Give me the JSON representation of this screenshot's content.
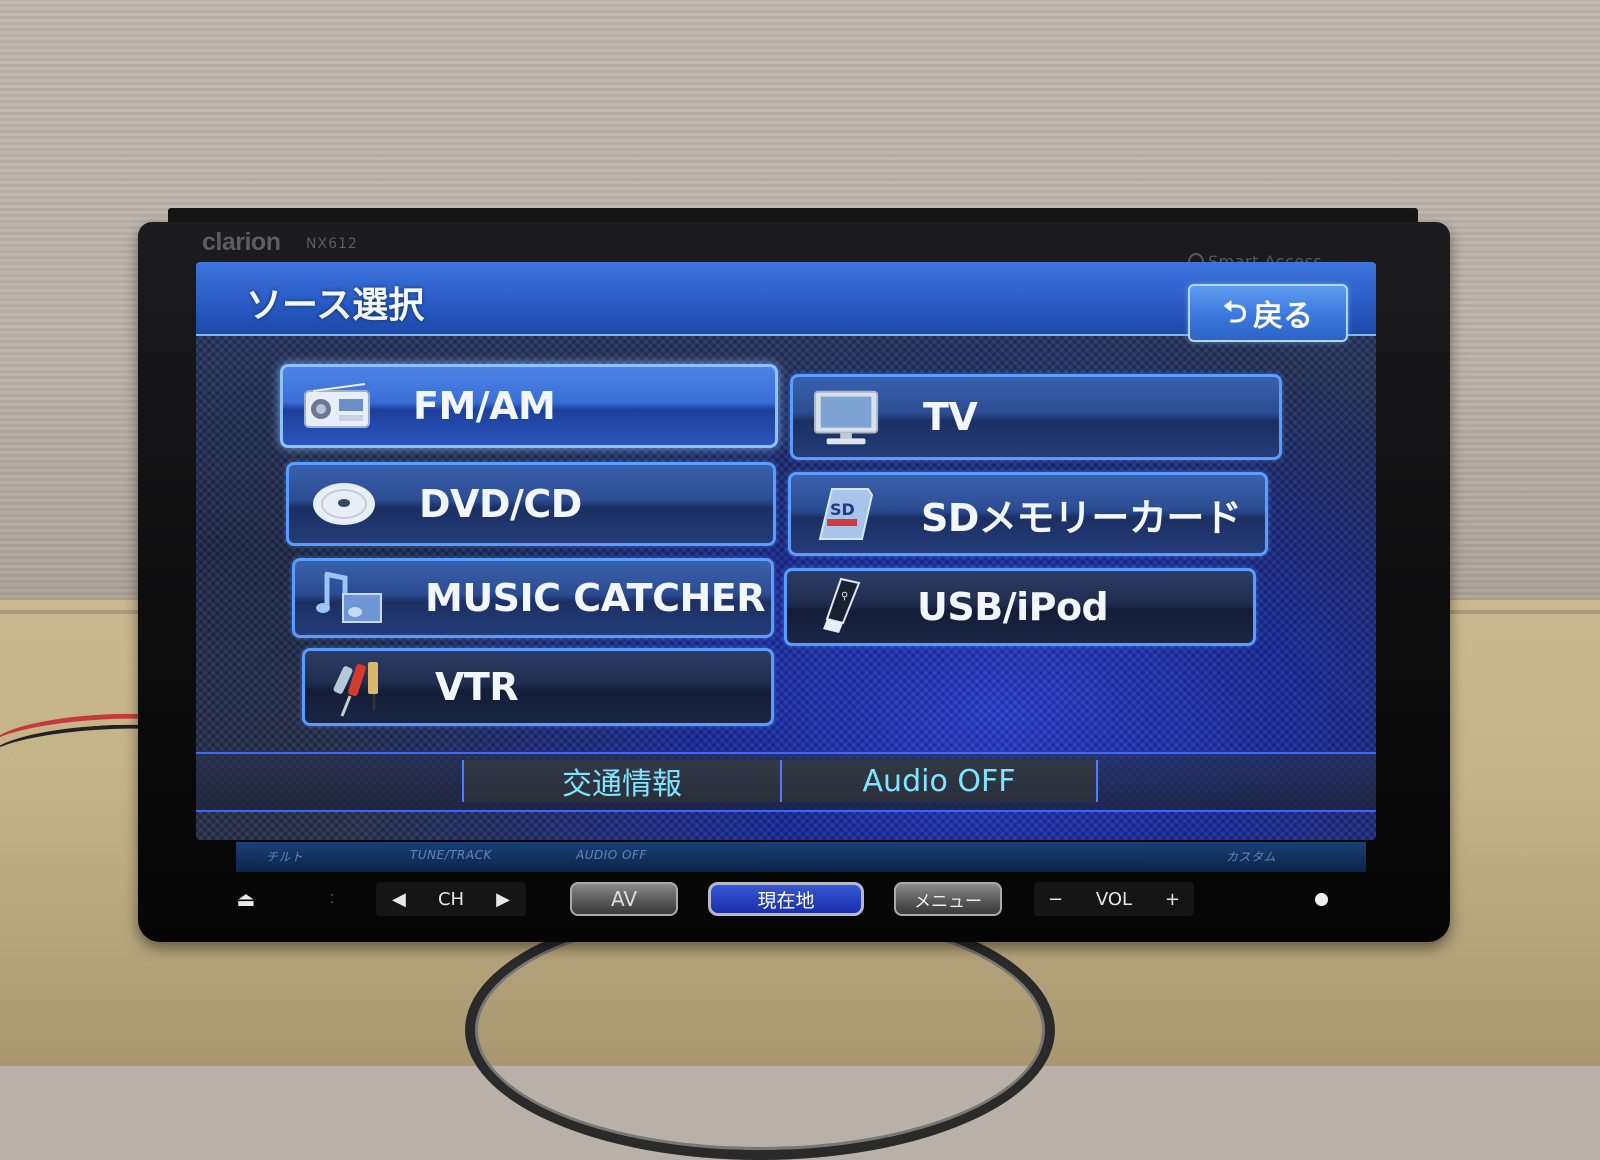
{
  "device": {
    "brand": "clarion",
    "model": "NX612",
    "feature_logo": "Smart Access"
  },
  "screen": {
    "title": "ソース選択",
    "back_button": {
      "icon": "return-arrow-icon",
      "label": "戻る"
    },
    "sources": [
      {
        "label": "FM/AM",
        "icon": "radio-icon",
        "selected": true
      },
      {
        "label": "TV",
        "icon": "tv-icon",
        "selected": false
      },
      {
        "label": "DVD/CD",
        "icon": "disc-icon",
        "selected": false
      },
      {
        "label": "SDメモリーカード",
        "icon": "sd-card-icon",
        "selected": false
      },
      {
        "label": "MUSIC CATCHER",
        "icon": "music-note-icon",
        "selected": false
      },
      {
        "label": "USB/iPod",
        "icon": "usb-stick-icon",
        "selected": false
      },
      {
        "label": "VTR",
        "icon": "rca-cable-icon",
        "selected": false
      }
    ],
    "bottom_bar": [
      {
        "label": "交通情報"
      },
      {
        "label": "Audio OFF"
      }
    ]
  },
  "bezel_reflection": {
    "left": "チルト",
    "middle": "TUNE/TRACK",
    "right": "AUDIO OFF",
    "far_right": "カスタム"
  },
  "hardware_buttons": {
    "eject": "⏏",
    "ch_label": "CH",
    "ch_prev": "◀",
    "ch_next": "▶",
    "av": "AV",
    "current_location": "現在地",
    "menu": "メニュー",
    "vol_label": "VOL",
    "vol_down": "−",
    "vol_up": "+"
  },
  "colors": {
    "title_bar": "#2a5cc6",
    "button_border": "#5b9cff",
    "bottom_text": "#7fe4ff",
    "current_location_button": "#2a40c0"
  }
}
